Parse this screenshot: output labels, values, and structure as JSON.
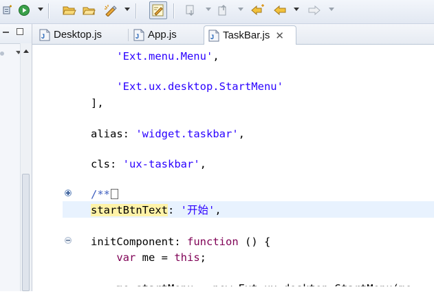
{
  "toolbar": {
    "buttons": [
      "new-project-icon",
      "run-icon",
      "open-folder-icon",
      "open-file-icon",
      "pencil-wand-icon",
      "mark-occurrences-toggle-icon",
      "next-annotation-icon",
      "previous-annotation-icon",
      "last-edit-location-icon",
      "back-arrow-icon",
      "forward-arrow-icon"
    ]
  },
  "tabs": [
    {
      "label": "Desktop.js",
      "active": false
    },
    {
      "label": "App.js",
      "active": false
    },
    {
      "label": "TaskBar.js",
      "active": true,
      "close": "✕"
    }
  ],
  "code": {
    "lines": [
      {
        "kind": "string",
        "indent": "    ",
        "text": "'Ext.menu.Menu'",
        "suffix": ","
      },
      {
        "kind": "blank"
      },
      {
        "kind": "string",
        "indent": "    ",
        "text": "'Ext.ux.desktop.StartMenu'",
        "suffix": ""
      },
      {
        "kind": "plain",
        "text": "],"
      },
      {
        "kind": "blank"
      },
      {
        "kind": "prop",
        "key": "alias",
        "value": "'widget.taskbar'",
        "suffix": ","
      },
      {
        "kind": "blank"
      },
      {
        "kind": "prop",
        "key": "cls",
        "value": "'ux-taskbar'",
        "suffix": ","
      },
      {
        "kind": "blank"
      },
      {
        "kind": "comment",
        "text": "/**"
      },
      {
        "kind": "highlight-prop",
        "key": "startBtnText",
        "value": "'开始'",
        "suffix": ","
      },
      {
        "kind": "blank"
      },
      {
        "kind": "func",
        "key": "initComponent",
        "keyword": "function",
        "rest": " () {"
      },
      {
        "kind": "var",
        "indent": "    ",
        "keyword": "var",
        "name": " me = ",
        "this_kw": "this",
        "suffix": ";"
      },
      {
        "kind": "blank"
      },
      {
        "kind": "partial",
        "indent": "    ",
        "text": "me.startMenu = new Ext.ux.desktop.StartMenu(me"
      }
    ]
  },
  "colors": {
    "string": "#2a00ff",
    "keyword": "#7f0055",
    "comment": "#3f5fbf",
    "current_line": "#e8f2fe",
    "occurrence_highlight": "#fff3a8"
  }
}
